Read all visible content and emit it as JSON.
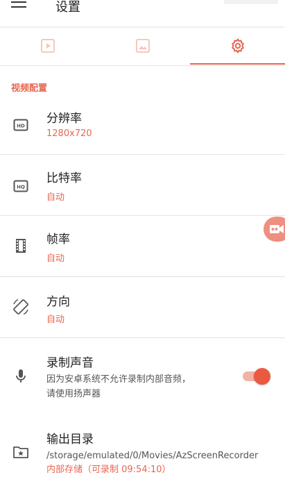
{
  "app": {
    "title": "设置"
  },
  "tabs": [
    {
      "icon": "video-play-icon"
    },
    {
      "icon": "image-icon"
    },
    {
      "icon": "gear-icon"
    }
  ],
  "section": {
    "title": "视频配置"
  },
  "settings": {
    "resolution": {
      "title": "分辨率",
      "value": "1280x720",
      "icon": "hd-icon"
    },
    "bitrate": {
      "title": "比特率",
      "value": "自动",
      "icon": "hq-icon"
    },
    "framerate": {
      "title": "帧率",
      "value": "自动",
      "icon": "film-icon"
    },
    "orientation": {
      "title": "方向",
      "value": "自动",
      "icon": "screen-rotation-icon"
    },
    "record_audio": {
      "title": "录制声音",
      "desc_line1": "因为安卓系统不允许录制内部音频，",
      "desc_line2": "请使用扬声器",
      "enabled": true,
      "icon": "microphone-icon"
    },
    "output_dir": {
      "title": "输出目录",
      "path": "/storage/emulated/0/Movies/AzScreenRecorder",
      "storage_info": "内部存储（可录制 09:54:10）",
      "icon": "folder-star-icon"
    }
  },
  "colors": {
    "accent": "#e8664f",
    "tab_inactive": "#f6c7bd"
  }
}
